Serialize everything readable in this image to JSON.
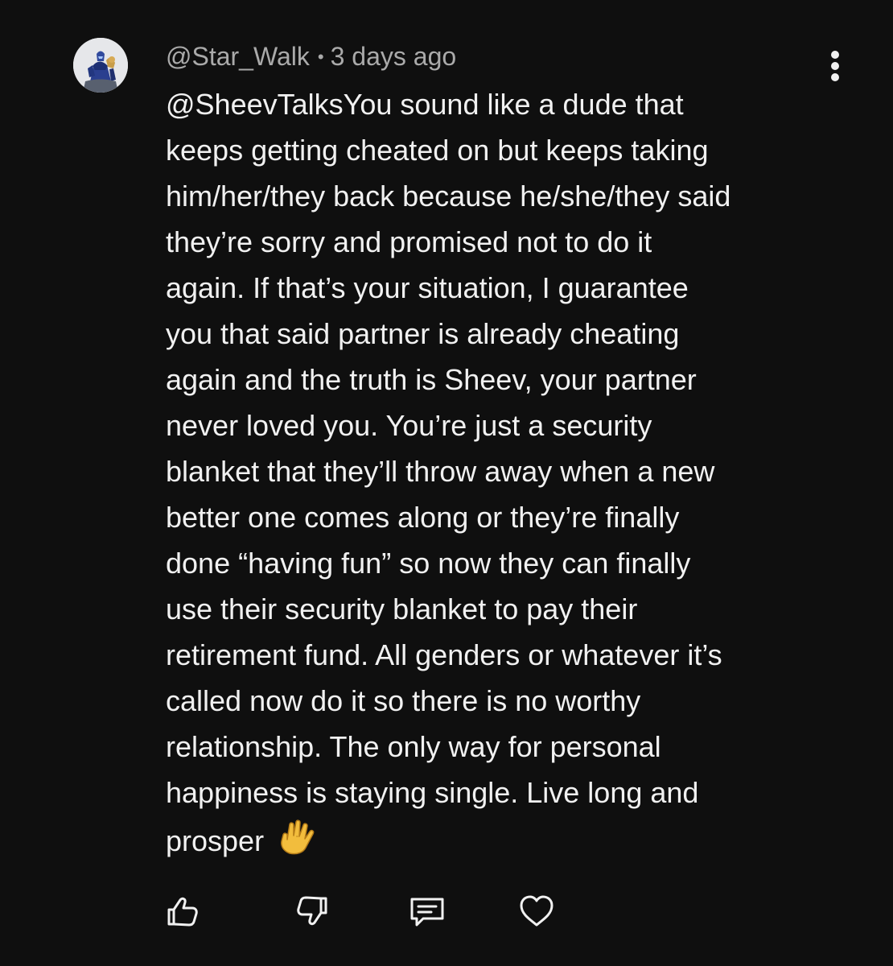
{
  "comment": {
    "author": "@Star_Walk",
    "separator": "•",
    "timestamp": "3 days ago",
    "lines": [
      "@SheevTalksYou sound like a dude that",
      "keeps getting cheated on but keeps taking",
      "him/her/they back because he/she/they said",
      "they’re sorry and promised not to do it",
      "again. If that’s your situation, I guarantee",
      "you that said partner is already cheating",
      "again and the truth is Sheev, your partner",
      "never loved you. You’re just a security",
      "blanket that they’ll throw away when a new",
      "better one comes along or they’re finally",
      "done “having fun” so now they can finally",
      "use their security blanket to pay their",
      "retirement fund. All genders or whatever it’s",
      "called now do it so there is no worthy",
      "relationship. The only way for personal",
      "happiness is staying single. Live long and",
      "prosper"
    ],
    "emoji": "vulcan-salute-emoji"
  },
  "actions": {
    "like_icon": "thumbs-up-icon",
    "dislike_icon": "thumbs-down-icon",
    "reply_icon": "comment-icon",
    "heart_icon": "heart-icon"
  },
  "menu_icon": "more-vertical-icon",
  "colors": {
    "background": "#0f0f0f",
    "text": "#f1f1f1",
    "meta": "#aaaaaa",
    "emoji": "#f2bd3d"
  }
}
